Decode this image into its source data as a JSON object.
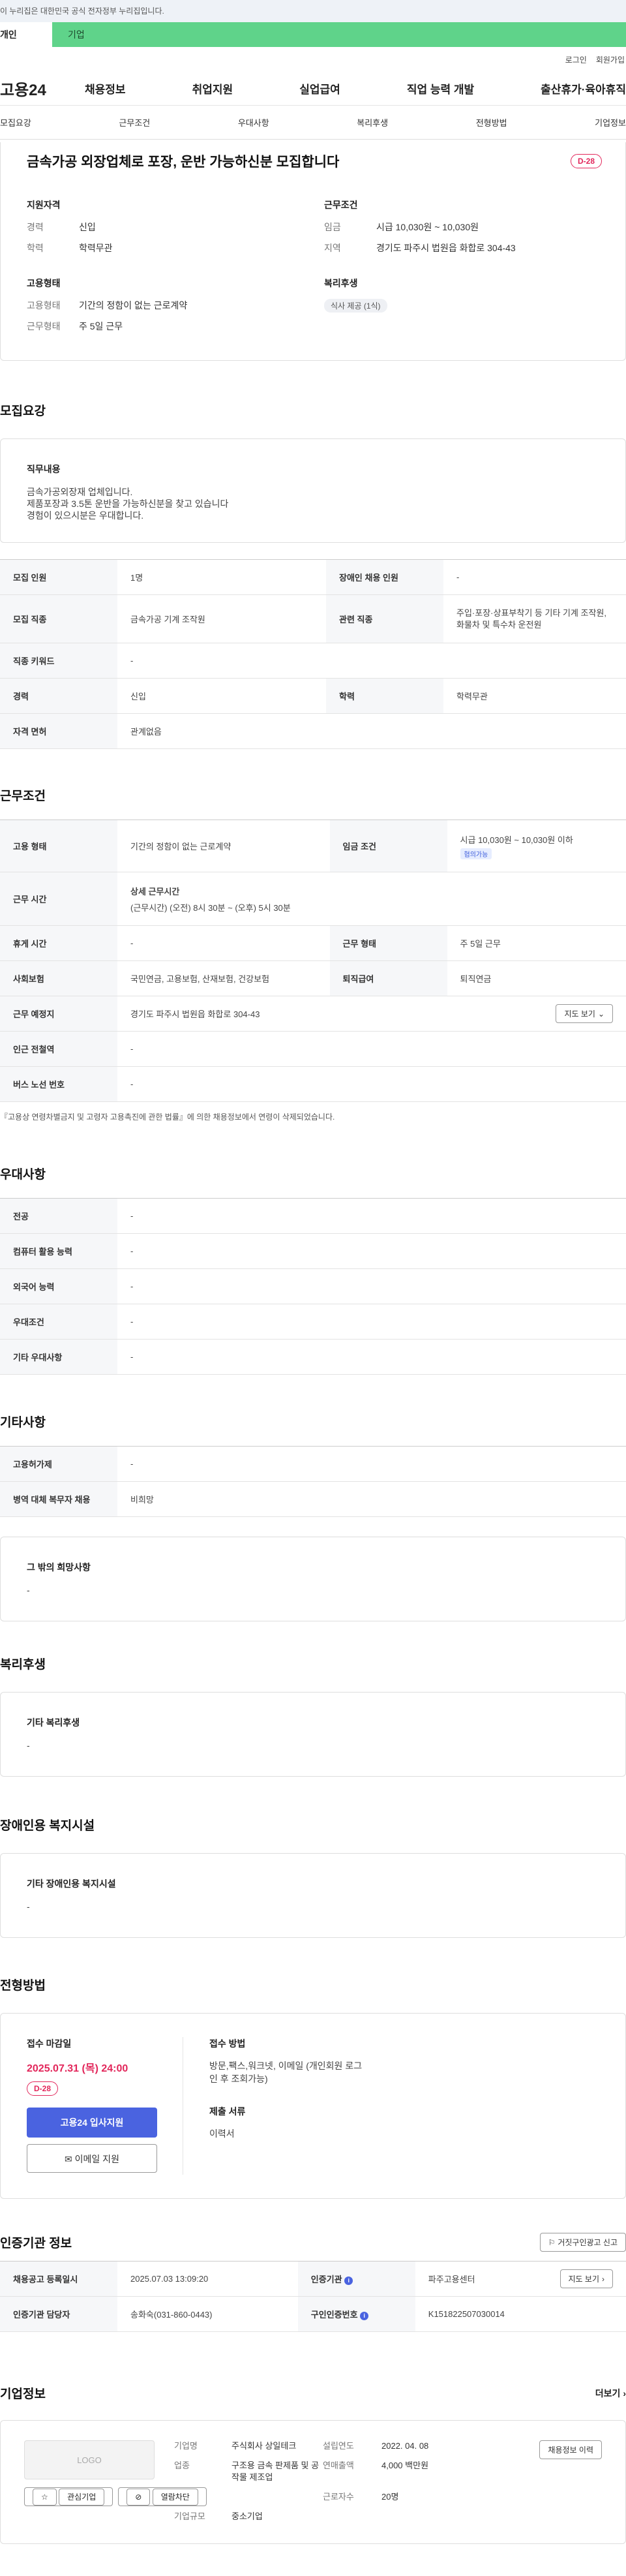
{
  "gov_banner": "이 누리집은 대한민국 공식 전자정부 누리집입니다.",
  "user_tabs": {
    "person": "개인",
    "corp": "기업"
  },
  "util": {
    "login": "로그인",
    "join": "회원가입"
  },
  "logo": "고용24",
  "gnb": [
    "채용정보",
    "취업지원",
    "실업급여",
    "직업 능력 개발",
    "출산휴가·육아휴직"
  ],
  "anchors": [
    "모집요강",
    "근무조건",
    "우대사항",
    "복리후생",
    "전형방법",
    "기업정보"
  ],
  "summary": {
    "title": "금속가공 외장업체로 포장, 운반 가능하신분 모집합니다",
    "dday": "D-28",
    "qual": {
      "h": "지원자격",
      "rows": [
        {
          "k": "경력",
          "v": "신입"
        },
        {
          "k": "학력",
          "v": "학력무관"
        }
      ]
    },
    "cond": {
      "h": "근무조건",
      "rows": [
        {
          "k": "임금",
          "v": "시급 10,030원 ~ 10,030원"
        },
        {
          "k": "지역",
          "v": "경기도 파주시 법원읍 화합로 304-43"
        }
      ]
    },
    "emp": {
      "h": "고용형태",
      "rows": [
        {
          "k": "고용형태",
          "v": "기간의 정함이 없는 근로계약"
        },
        {
          "k": "근무형태",
          "v": "주 5일 근무"
        }
      ]
    },
    "welfare": {
      "h": "복리후생",
      "chip": "식사 제공 (1식)"
    }
  },
  "recruit": {
    "title": "모집요강",
    "duty_h": "직무내용",
    "duty_lines": [
      "금속가공외장재 업체입니다.",
      "제품포장과 3.5톤 운반을 가능하신분을 찾고 있습니다",
      "경험이 있으시분은 우대합니다."
    ],
    "rows": [
      {
        "h1": "모집 인원",
        "v1": "1명",
        "h2": "장애인 채용 인원",
        "v2": "-"
      },
      {
        "h1": "모집 직종",
        "v1": "금속가공 기계 조작원",
        "h2": "관련 직종",
        "v2": "주입·포장·상표부착기 등 기타 기계 조작원, 화물차 및 특수차 운전원"
      },
      {
        "h1": "직종 키워드",
        "v1": "-"
      },
      {
        "h1": "경력",
        "v1": "신입",
        "h2": "학력",
        "v2": "학력무관"
      },
      {
        "h1": "자격 면허",
        "v1": "관계없음"
      }
    ]
  },
  "work": {
    "title": "근무조건",
    "emp_type_h": "고용 형태",
    "emp_type_v": "기간의 정함이 없는 근로계약",
    "wage_h": "임금 조건",
    "wage_v": "시급 10,030원 ~ 10,030원 이하",
    "wage_pill": "협의가능",
    "hours_h": "근무 시간",
    "hours_title": "상세 근무시간",
    "hours_v": "(근무시간) (오전) 8시 30분 ~ (오후) 5시 30분",
    "rest_h": "휴게 시간",
    "rest_v": "-",
    "form_h": "근무 형태",
    "form_v": "주 5일 근무",
    "ins_h": "사회보험",
    "ins_v": "국민연금, 고용보험, 산재보험, 건강보험",
    "ret_h": "퇴직급여",
    "ret_v": "퇴직연금",
    "loc_h": "근무 예정지",
    "loc_v": "경기도 파주시 법원읍 화합로 304-43",
    "map_btn": "지도 보기",
    "subway_h": "인근 전철역",
    "subway_v": "-",
    "bus_h": "버스 노선 번호",
    "bus_v": "-",
    "note": "『고용상 연령차별금지 및 고령자 고용촉진에 관한 법률』에 의한 채용정보에서 연령이 삭제되었습니다."
  },
  "pref": {
    "title": "우대사항",
    "rows": [
      {
        "h": "전공",
        "v": "-"
      },
      {
        "h": "컴퓨터 활용 능력",
        "v": "-"
      },
      {
        "h": "외국어 능력",
        "v": "-"
      },
      {
        "h": "우대조건",
        "v": "-"
      },
      {
        "h": "기타 우대사항",
        "v": "-"
      }
    ]
  },
  "etc": {
    "title": "기타사항",
    "rows": [
      {
        "h": "고용허가제",
        "v": "-"
      },
      {
        "h": "병역 대체 복무자 채용",
        "v": "비희망"
      }
    ],
    "box_h": "그 밖의 희망사항",
    "box_v": "-"
  },
  "welfare": {
    "title": "복리후생",
    "box_h": "기타 복리후생",
    "box_v": "-"
  },
  "disabled": {
    "title": "장애인용 복지시설",
    "box_h": "기타 장애인용 복지시설",
    "box_v": "-"
  },
  "apply": {
    "title": "전형방법",
    "deadline_h": "접수 마감일",
    "deadline": "2025.07.31 (목) 24:00",
    "dday": "D-28",
    "btn_apply": "고용24 입사지원",
    "btn_email": "이메일 지원",
    "method_h": "접수 방법",
    "method_v": "방문,팩스,워크넷, 이메일 (개인회원 로그인 후 조회가능)",
    "docs_h": "제출 서류",
    "docs_v": "이력서"
  },
  "cert": {
    "title": "인증기관 정보",
    "report_btn": "거짓구인광고 신고",
    "r1": {
      "h1": "채용공고 등록일시",
      "v1": "2025.07.03 13:09:20",
      "h2": "인증기관",
      "v2": "파주고용센터",
      "btn": "지도 보기"
    },
    "r2": {
      "h1": "인증기관 담당자",
      "v1": "송화숙(031-860-0443)",
      "h2": "구인인증번호",
      "v2": "K151822507030014"
    }
  },
  "company": {
    "title": "기업정보",
    "more": "더보기",
    "logo": "LOGO",
    "btn_fav": "관심기업",
    "btn_block": "열람차단",
    "btn_history": "채용정보 이력",
    "name_k": "기업명",
    "name_v": "주식회사 상일테크",
    "est_k": "설립연도",
    "est_v": "2022. 04. 08",
    "sales_k": "연매출액",
    "sales_v": "4,000 백만원",
    "ind_k": "업종",
    "ind_v": "구조용 금속 판제품 및 공작물 제조업",
    "emp_k": "근로자수",
    "emp_v": "20명",
    "size_k": "기업규모",
    "size_v": "중소기업"
  }
}
